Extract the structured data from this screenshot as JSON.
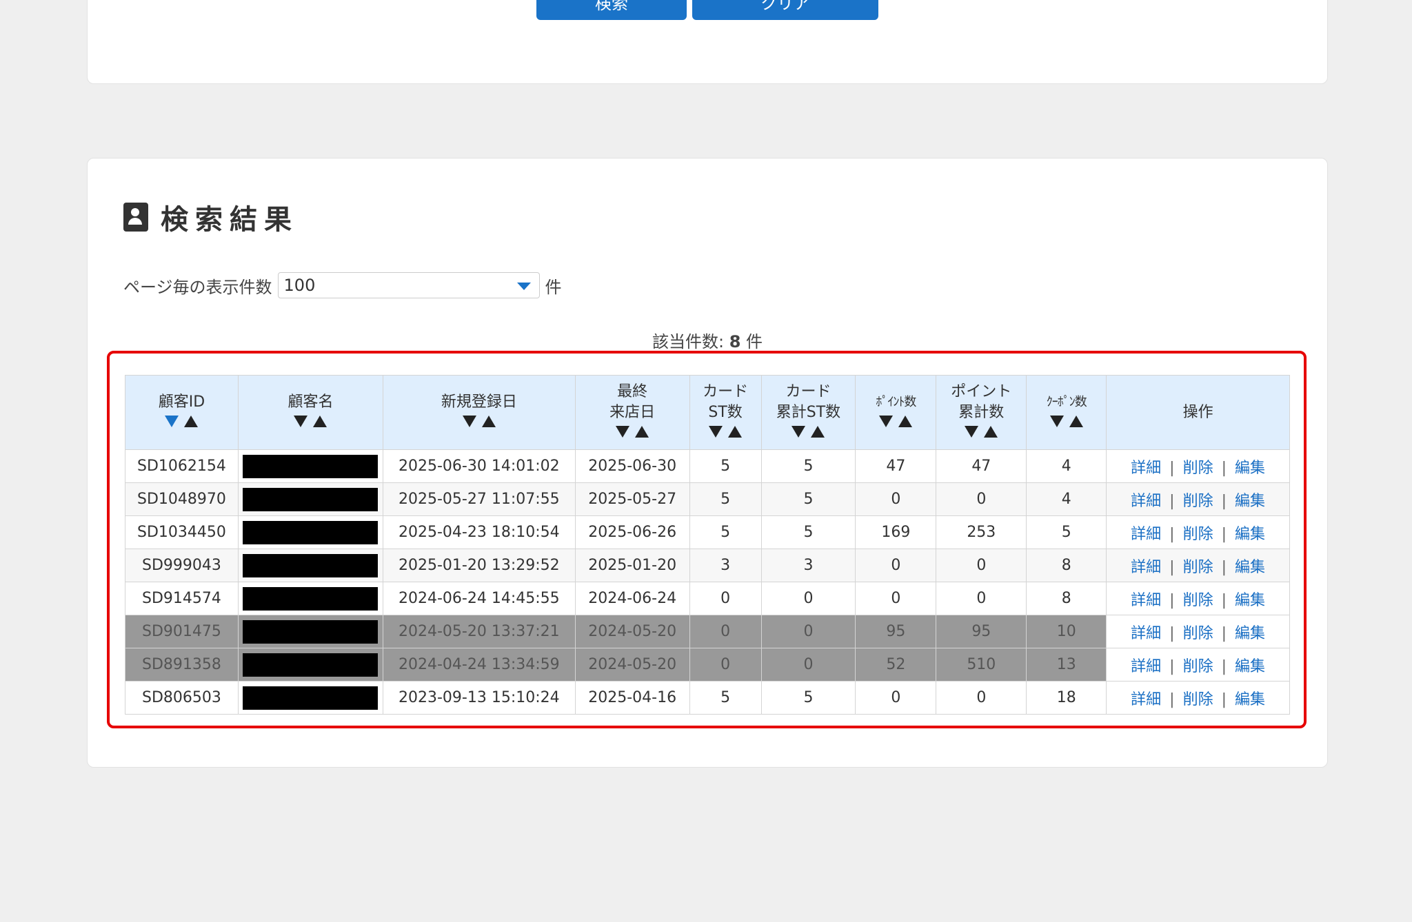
{
  "top_buttons": {
    "search_label": "検索",
    "clear_label": "クリア"
  },
  "result": {
    "title": "検索結果",
    "per_page_label": "ページ毎の表示件数",
    "per_page_value": "100",
    "per_page_unit": "件",
    "count_prefix": "該当件数: ",
    "count_value": "8",
    "count_unit": " 件"
  },
  "table": {
    "headers": {
      "customer_id": "顧客ID",
      "customer_name": "顧客名",
      "registered": "新規登録日",
      "last_visit_1": "最終",
      "last_visit_2": "来店日",
      "card_st_1": "カード",
      "card_st_2": "ST数",
      "card_total_1": "カード",
      "card_total_2": "累計ST数",
      "points": "ﾎﾟｲﾝﾄ数",
      "points_total_1": "ポイント",
      "points_total_2": "累計数",
      "coupons": "ｸｰﾎﾟﾝ数",
      "ops": "操作"
    },
    "op_labels": {
      "detail": "詳細",
      "delete": "削除",
      "edit": "編集",
      "sep": "|"
    },
    "rows": [
      {
        "id": "SD1062154",
        "registered": "2025-06-30 14:01:02",
        "last_visit": "2025-06-30",
        "card_st": "5",
        "card_total": "5",
        "points": "47",
        "points_total": "47",
        "coupons": "4",
        "style": "odd"
      },
      {
        "id": "SD1048970",
        "registered": "2025-05-27 11:07:55",
        "last_visit": "2025-05-27",
        "card_st": "5",
        "card_total": "5",
        "points": "0",
        "points_total": "0",
        "coupons": "4",
        "style": "even"
      },
      {
        "id": "SD1034450",
        "registered": "2025-04-23 18:10:54",
        "last_visit": "2025-06-26",
        "card_st": "5",
        "card_total": "5",
        "points": "169",
        "points_total": "253",
        "coupons": "5",
        "style": "odd"
      },
      {
        "id": "SD999043",
        "registered": "2025-01-20 13:29:52",
        "last_visit": "2025-01-20",
        "card_st": "3",
        "card_total": "3",
        "points": "0",
        "points_total": "0",
        "coupons": "8",
        "style": "even"
      },
      {
        "id": "SD914574",
        "registered": "2024-06-24 14:45:55",
        "last_visit": "2024-06-24",
        "card_st": "0",
        "card_total": "0",
        "points": "0",
        "points_total": "0",
        "coupons": "8",
        "style": "odd"
      },
      {
        "id": "SD901475",
        "registered": "2024-05-20 13:37:21",
        "last_visit": "2024-05-20",
        "card_st": "0",
        "card_total": "0",
        "points": "95",
        "points_total": "95",
        "coupons": "10",
        "style": "grey"
      },
      {
        "id": "SD891358",
        "registered": "2024-04-24 13:34:59",
        "last_visit": "2024-05-20",
        "card_st": "0",
        "card_total": "0",
        "points": "52",
        "points_total": "510",
        "coupons": "13",
        "style": "grey"
      },
      {
        "id": "SD806503",
        "registered": "2023-09-13 15:10:24",
        "last_visit": "2025-04-16",
        "card_st": "5",
        "card_total": "5",
        "points": "0",
        "points_total": "0",
        "coupons": "18",
        "style": "odd"
      }
    ]
  },
  "colors": {
    "accent": "#1a73c8",
    "highlight": "#e60000",
    "header_bg": "#dfeefd",
    "inactive_row": "#999999"
  }
}
